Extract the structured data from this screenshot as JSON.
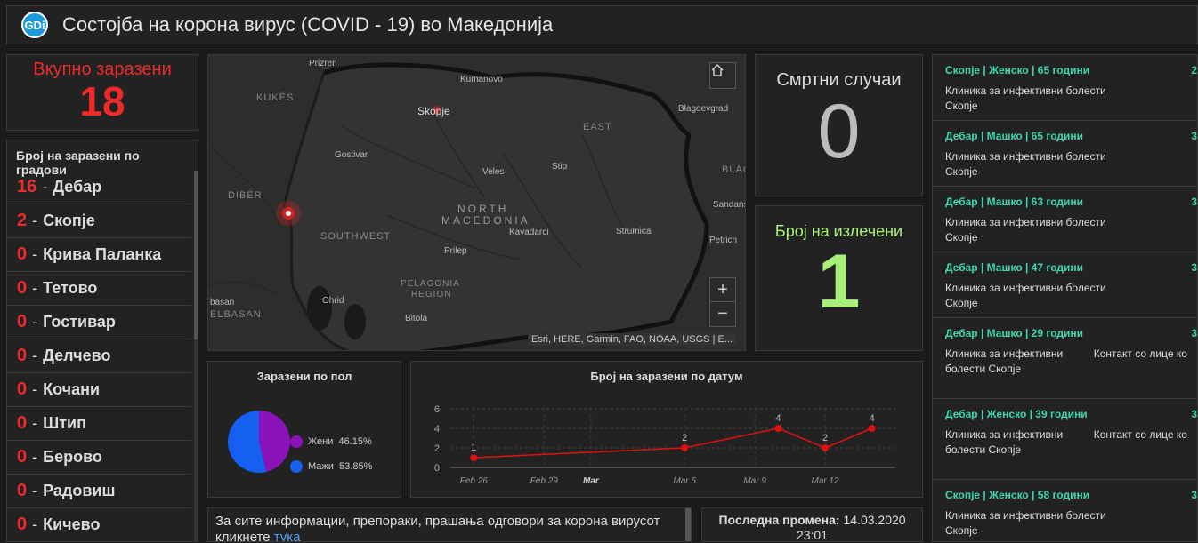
{
  "header": {
    "logo_text": "GDi",
    "title": "Состојба на корона вирус (COVID - 19) во Македонија"
  },
  "total": {
    "label": "Вкупно заразени",
    "value": "18"
  },
  "cities": {
    "header": "Број на заразени по градови",
    "items": [
      {
        "count": "16",
        "name": "Дебар"
      },
      {
        "count": "2",
        "name": "Скопје"
      },
      {
        "count": "0",
        "name": "Крива Паланка"
      },
      {
        "count": "0",
        "name": "Тетово"
      },
      {
        "count": "0",
        "name": "Гостивар"
      },
      {
        "count": "0",
        "name": "Делчево"
      },
      {
        "count": "0",
        "name": "Кочани"
      },
      {
        "count": "0",
        "name": "Штип"
      },
      {
        "count": "0",
        "name": "Берово"
      },
      {
        "count": "0",
        "name": "Радовиш"
      },
      {
        "count": "0",
        "name": "Кичево"
      }
    ]
  },
  "map": {
    "places": [
      "Prizren",
      "Kumanovo",
      "Skopje",
      "Blagoevgrad",
      "Gostivar",
      "Veles",
      "Stip",
      "Kavadarci",
      "Strumica",
      "Prilep",
      "Bitola",
      "Ohrid",
      "Petrich",
      "Sandanski",
      "basan",
      "KUKËS",
      "DIBËR",
      "SOUTHWEST",
      "EAST",
      "NORTH",
      "MACEDONIA",
      "PELAGONIA",
      "REGION",
      "ELBASAN",
      "BLAG"
    ],
    "attribution": "Esri, HERE, Garmin, FAO, NOAA, USGS | E...",
    "zoom_in": "+",
    "zoom_out": "−"
  },
  "deaths": {
    "label": "Смртни случаи",
    "value": "0"
  },
  "recovered": {
    "label": "Број на излечени",
    "value": "1"
  },
  "cases": [
    {
      "title": "Скопје | Женско | 65 години",
      "col1": "Клиника за инфективни болести Скопје",
      "col2": "",
      "num": "2"
    },
    {
      "title": "Дебар | Машко | 65 години",
      "col1": "Клиника за инфективни болести Скопје",
      "col2": "",
      "num": "3"
    },
    {
      "title": "Дебар | Машко | 63 години",
      "col1": "Клиника за инфективни болести Скопје",
      "col2": "",
      "num": "3"
    },
    {
      "title": "Дебар | Машко | 47 години",
      "col1": "Клиника за инфективни болести Скопје",
      "col2": "",
      "num": "3"
    },
    {
      "title": "Дебар | Машко | 29 години",
      "col1": "Клиника за инфективни болести Скопје",
      "col2": "Контакт со лице ко",
      "num": "3"
    },
    {
      "title": "Дебар | Женско | 39 години",
      "col1": "Клиника за инфективни болести Скопје",
      "col2": "Контакт со лице ко",
      "num": "3"
    },
    {
      "title": "Скопје | Женско | 58 години",
      "col1": "Клиника за инфективни болести Скопје",
      "col2": "",
      "num": "3"
    }
  ],
  "gender_chart": {
    "title": "Заразени по пол",
    "chart_data": {
      "type": "pie",
      "slices": [
        {
          "name": "Жени",
          "value": 46.15,
          "label": "46.15%",
          "color": "#8a12b8"
        },
        {
          "name": "Мажи",
          "value": 53.85,
          "label": "53.85%",
          "color": "#1560f0"
        }
      ]
    }
  },
  "date_chart": {
    "title": "Број на заразени по датум",
    "chart_data": {
      "type": "line",
      "x": [
        "2020-02-26",
        "2020-03-06",
        "2020-03-10",
        "2020-03-12",
        "2020-03-14"
      ],
      "values": [
        1,
        2,
        4,
        2,
        4
      ],
      "labels": [
        "1",
        "2",
        "4",
        "2",
        "4"
      ],
      "ylim": [
        0,
        6
      ],
      "yticks": [
        "0",
        "2",
        "4",
        "6"
      ],
      "xticks": [
        "Feb 26",
        "Feb 29",
        "Mar",
        "Mar 6",
        "Mar 9",
        "Mar 12"
      ],
      "color": "#e01010"
    }
  },
  "info": {
    "text": "За сите информации, препораки, прашања одговори за корона вирусот кликнете ",
    "link": "тука"
  },
  "last_update": {
    "label": "Последна промена:",
    "date": "14.03.2020",
    "time": "23:01"
  }
}
